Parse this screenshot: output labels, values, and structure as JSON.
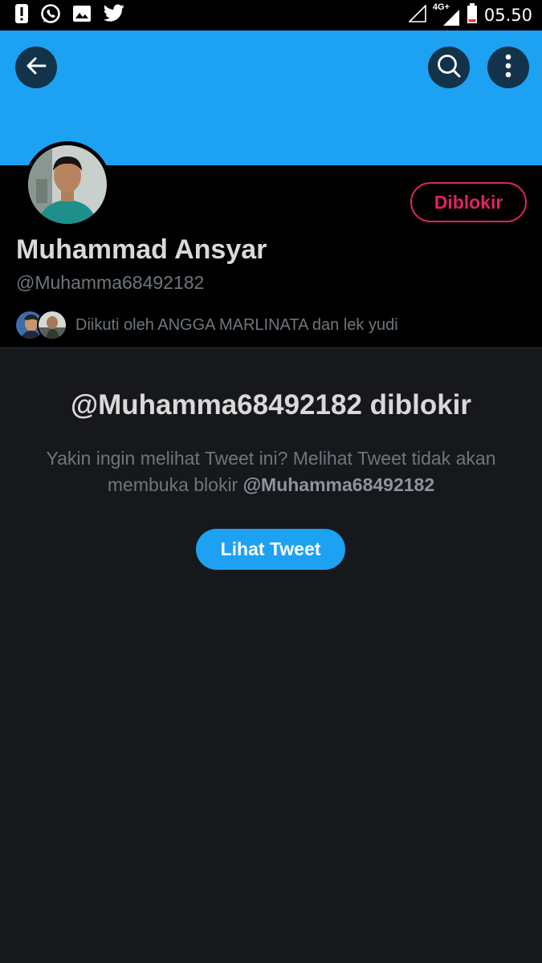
{
  "status_bar": {
    "time": "05.50",
    "network": "4G+",
    "icons": [
      "alert-icon",
      "whatsapp-icon",
      "image-icon",
      "twitter-icon",
      "signal-empty-icon",
      "signal-4g-icon",
      "battery-icon"
    ]
  },
  "header": {
    "back_icon": "back-arrow-icon",
    "search_icon": "search-icon",
    "more_icon": "more-vertical-icon",
    "banner_color": "#1da1f2"
  },
  "profile": {
    "display_name": "Muhammad Ansyar",
    "handle": "@Muhamma68492182",
    "block_button_label": "Diblokir",
    "followed_by_text": "Diikuti oleh ANGGA MARLINATA dan lek yudi"
  },
  "blocked_notice": {
    "title": "@Muhamma68492182 diblokir",
    "body_prefix": "Yakin ingin melihat Tweet ini? Melihat Tweet tidak akan membuka blokir ",
    "body_handle": "@Muhamma68492182",
    "view_button_label": "Lihat Tweet"
  },
  "colors": {
    "accent": "#1da1f2",
    "blocked": "#e0245e",
    "background": "#16181c"
  }
}
